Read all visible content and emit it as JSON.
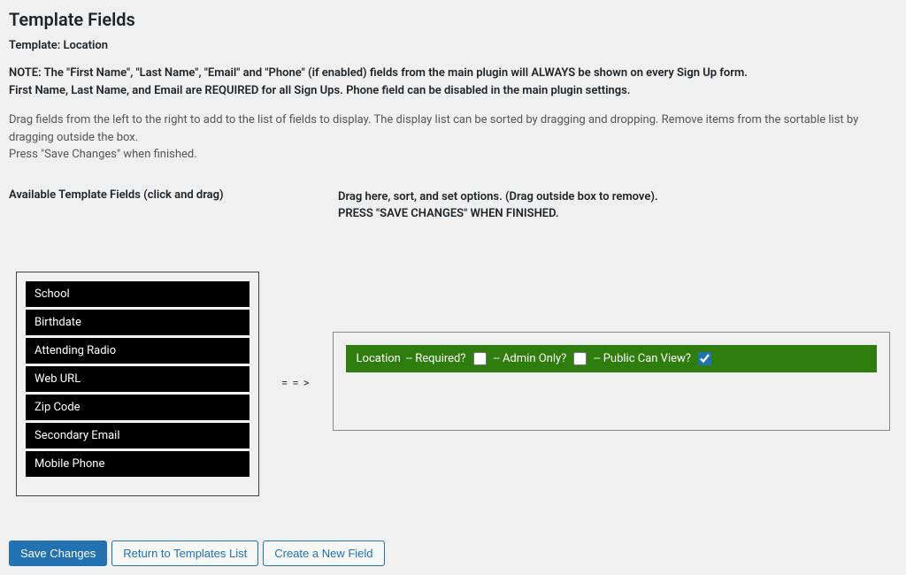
{
  "header": {
    "title": "Template Fields",
    "template_label": "Template:",
    "template_name": "Location"
  },
  "note": {
    "line1": "NOTE: The \"First Name\", \"Last Name\", \"Email\" and \"Phone\" (if enabled) fields from the main plugin will ALWAYS be shown on every Sign Up form.",
    "line2": "First Name, Last Name, and Email are REQUIRED for all Sign Ups. Phone field can be disabled in the main plugin settings."
  },
  "instructions": {
    "line1": "Drag fields from the left to the right to add to the list of fields to display. The display list can be sorted by dragging and dropping. Remove items from the sortable list by dragging outside the box.",
    "line2": "Press \"Save Changes\" when finished."
  },
  "columns": {
    "available_heading": "Available Template Fields (click and drag)",
    "drop_heading_line1": "Drag here, sort, and set options. (Drag outside box to remove).",
    "drop_heading_line2": "PRESS \"SAVE CHANGES\" WHEN FINISHED.",
    "arrow": "= = >"
  },
  "available_fields": [
    "School",
    "Birthdate",
    "Attending Radio",
    "Web URL",
    "Zip Code",
    "Secondary Email",
    "Mobile Phone"
  ],
  "selected_fields": [
    {
      "name": "Location",
      "required_label": "-- Required?",
      "admin_only_label": "-- Admin Only?",
      "public_view_label": "-- Public Can View?",
      "required": false,
      "admin_only": false,
      "public_can_view": true
    }
  ],
  "buttons": {
    "save": "Save Changes",
    "return": "Return to Templates List",
    "create": "Create a New Field"
  }
}
